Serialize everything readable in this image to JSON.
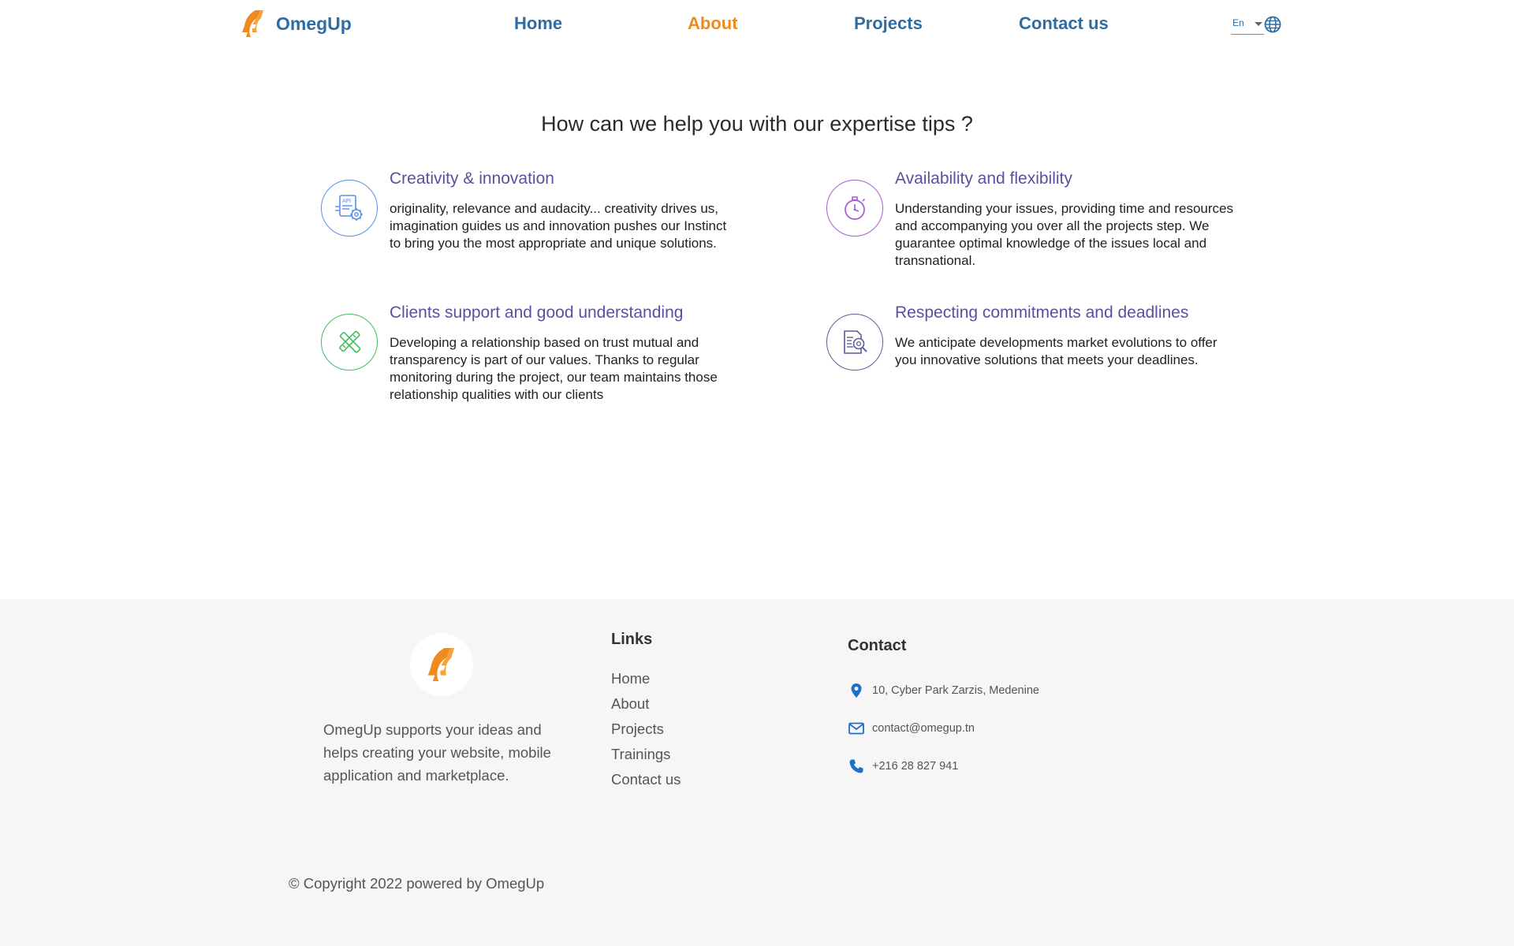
{
  "header": {
    "brand": "OmegUp",
    "nav": [
      "Home",
      "About",
      "Projects",
      "Contact us"
    ],
    "active_nav": "About",
    "language": "En"
  },
  "main": {
    "title": "How can we help you with our expertise tips ?",
    "features": [
      {
        "title": "Creativity & innovation",
        "text": "originality, relevance and audacity... creativity drives us, imagination guides us and innovation pushes our Instinct to bring you the most appropriate and unique solutions.",
        "icon": "api-gear-icon",
        "color": "#5b8ee6"
      },
      {
        "title": "Availability and flexibility",
        "text": "Understanding your issues, providing time and resources and accompanying you over all the projects step. We guarantee optimal knowledge of the issues local and transnational.",
        "icon": "stopwatch-icon",
        "color": "#a45bd6"
      },
      {
        "title": "Clients support and good understanding",
        "text": "Developing a relationship based on trust mutual and transparency is part of our values. Thanks to regular monitoring during the project, our team maintains those relationship qualities with our clients",
        "icon": "tools-icon",
        "color": "#3fbf5f"
      },
      {
        "title": "Respecting commitments and deadlines",
        "text": "We anticipate developments market evolutions to offer you innovative solutions that meets your deadlines.",
        "icon": "document-search-icon",
        "color": "#5a5f99"
      }
    ]
  },
  "footer": {
    "about": "OmegUp supports your ideas and helps creating your website, mobile application and marketplace.",
    "links_title": "Links",
    "links": [
      "Home",
      "About",
      "Projects",
      "Trainings",
      "Contact us"
    ],
    "contact_title": "Contact",
    "address": "10, Cyber Park Zarzis, Medenine",
    "email": "contact@omegup.tn",
    "phone": "+216 28 827 941",
    "copyright": "© Copyright 2022 powered by OmegUp"
  },
  "colors": {
    "brand_blue": "#2e6da4",
    "accent_orange": "#ee8a1e",
    "feature_title_purple": "#5d4e9f",
    "footer_bg": "#f6f6f6"
  }
}
